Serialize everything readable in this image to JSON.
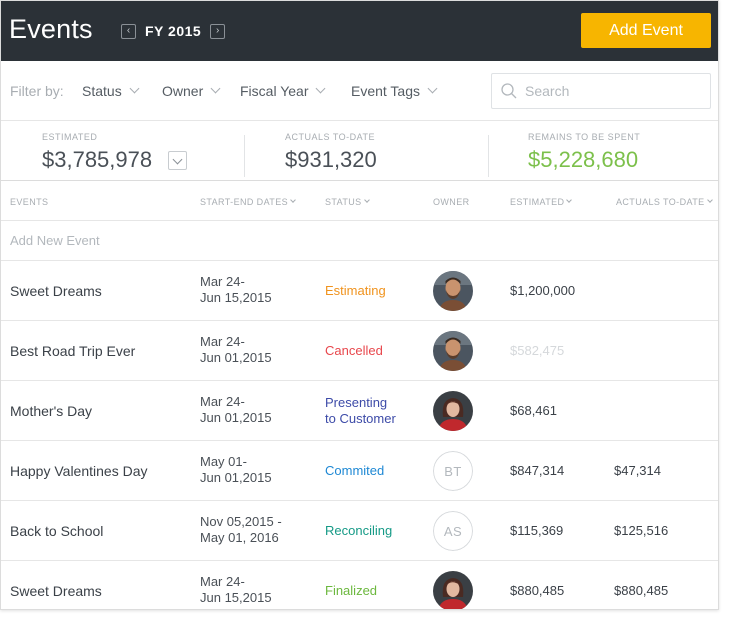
{
  "header": {
    "title": "Events",
    "fiscal_year": "FY 2015",
    "prev_glyph": "‹",
    "next_glyph": "›",
    "add_button": "Add Event"
  },
  "filters": {
    "label": "Filter by:",
    "items": [
      {
        "label": "Status"
      },
      {
        "label": "Owner"
      },
      {
        "label": "Fiscal Year"
      },
      {
        "label": "Event Tags"
      }
    ],
    "search_placeholder": "Search"
  },
  "summary": {
    "estimated": {
      "label": "ESTIMATED",
      "value": "$3,785,978"
    },
    "actuals": {
      "label": "ACTUALS TO-DATE",
      "value": "$931,320"
    },
    "remains": {
      "label": "REMAINS TO BE SPENT",
      "value": "$5,228,680"
    }
  },
  "table": {
    "columns": {
      "events": "EVENTS",
      "dates": "START-END DATES",
      "status": "STATUS",
      "owner": "OWNER",
      "estimated": "ESTIMATED",
      "actuals": "ACTUALS TO-DATE"
    },
    "add_new": "Add New Event",
    "rows": [
      {
        "name": "Sweet Dreams",
        "dates": [
          "Mar 24-",
          "Jun 15,2015"
        ],
        "status": [
          "Estimating"
        ],
        "status_color": "#f0931e",
        "owner": "photo-man",
        "owner_initials": "",
        "estimated": "$1,200,000",
        "actuals": ""
      },
      {
        "name": "Best Road Trip Ever",
        "dates": [
          "Mar 24-",
          "Jun 01,2015"
        ],
        "status": [
          "Cancelled"
        ],
        "status_color": "#e8474c",
        "owner": "photo-man",
        "owner_initials": "",
        "estimated": "$582,475",
        "actuals": ""
      },
      {
        "name": "Mother's Day",
        "dates": [
          "Mar 24-",
          "Jun 01,2015"
        ],
        "status": [
          "Presenting",
          "to Customer"
        ],
        "status_color": "#3d4ba8",
        "owner": "photo-woman",
        "owner_initials": "",
        "estimated": "$68,461",
        "actuals": ""
      },
      {
        "name": "Happy Valentines Day",
        "dates": [
          "May 01-",
          "Jun 01,2015"
        ],
        "status": [
          "Commited"
        ],
        "status_color": "#1e88d4",
        "owner": "initials",
        "owner_initials": "BT",
        "estimated": "$847,314",
        "actuals": "$47,314"
      },
      {
        "name": "Back to School",
        "dates": [
          "Nov 05,2015 -",
          "May 01, 2016"
        ],
        "status": [
          "Reconciling"
        ],
        "status_color": "#159a86",
        "owner": "initials",
        "owner_initials": "AS",
        "estimated": "$115,369",
        "actuals": "$125,516"
      },
      {
        "name": "Sweet Dreams",
        "dates": [
          "Mar 24-",
          "Jun 15,2015"
        ],
        "status": [
          "Finalized"
        ],
        "status_color": "#6cb83e",
        "owner": "photo-woman",
        "owner_initials": "",
        "estimated": "$880,485",
        "actuals": "$880,485"
      }
    ]
  },
  "colors": {
    "header_bg": "#2b3137",
    "accent": "#f7b500",
    "remains_green": "#7cc04b"
  }
}
